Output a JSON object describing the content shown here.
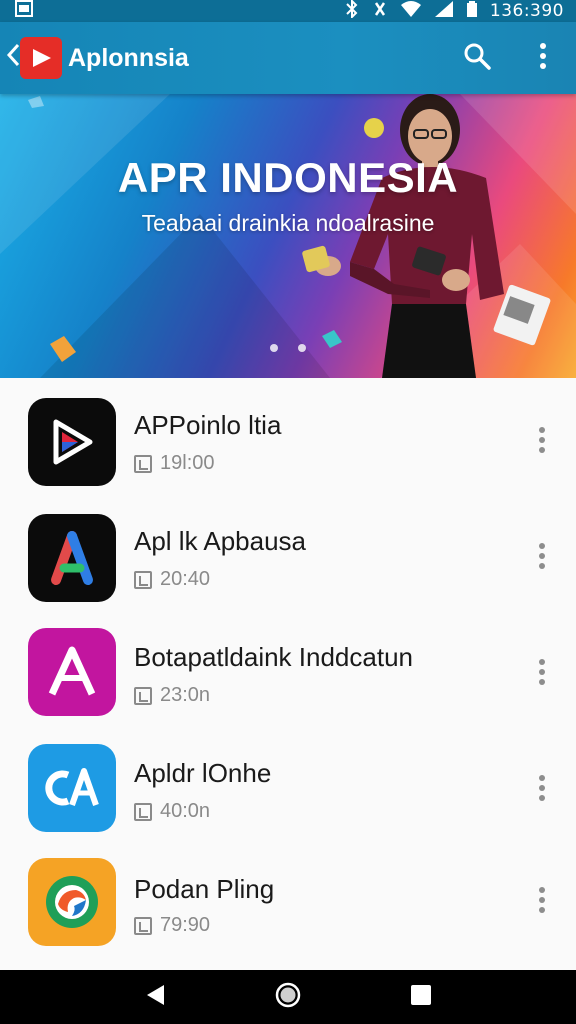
{
  "status_bar": {
    "time": "136:390",
    "icons": [
      "screenshot-icon",
      "bluetooth-icon",
      "vibrate-icon",
      "wifi-icon",
      "signal-icon",
      "battery-icon"
    ]
  },
  "app_bar": {
    "title": "Aplonnsia",
    "icons": [
      "back-icon",
      "app-logo-icon",
      "search-icon",
      "more-vert-icon"
    ]
  },
  "banner": {
    "title": "APR INDONESIA",
    "subtitle": "Teabaai drainkia ndoalrasine",
    "page_indicator_count": 2
  },
  "apps": [
    {
      "name": "APPoinlo ltia",
      "meta": "19l:00",
      "icon": "play-app-icon",
      "icon_bg": "#0b0b0b"
    },
    {
      "name": "Apl lk Apbausa",
      "meta": "20:40",
      "icon": "triangle-a-app-icon",
      "icon_bg": "#0b0b0b"
    },
    {
      "name": "Botapatldaink Inddcatun",
      "meta": "23:0n",
      "icon": "letter-a-app-icon",
      "icon_bg": "#c2159f"
    },
    {
      "name": "Apldr lOnhe",
      "meta": "40:0n",
      "icon": "ca-app-icon",
      "icon_bg": "#1e9be4"
    },
    {
      "name": "Podan Pling",
      "meta": "79:90",
      "icon": "circle-swirl-app-icon",
      "icon_bg": "#f5a325"
    }
  ],
  "nav_bar": {
    "icons": [
      "back-triangle-icon",
      "home-circle-icon",
      "recents-square-icon"
    ]
  },
  "colors": {
    "status_bar": "#0d6e96",
    "app_bar": "#1a8ac0",
    "logo_red": "#e52d27"
  }
}
